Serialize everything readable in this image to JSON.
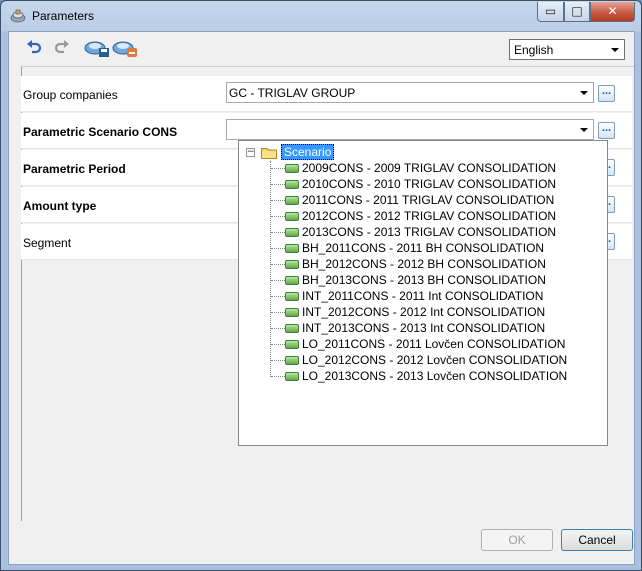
{
  "window": {
    "title": "Parameters"
  },
  "caption_buttons": {
    "minimize": "▭",
    "maximize": "□",
    "close": "✕"
  },
  "toolbar": {
    "icons": [
      "undo-icon",
      "redo-icon",
      "save-settings-icon",
      "delete-settings-icon"
    ],
    "language": "English"
  },
  "params": {
    "rows": [
      {
        "label": "Group companies",
        "value": "GC - TRIGLAV GROUP"
      },
      {
        "label": "Parametric Scenario CONS",
        "value": ""
      },
      {
        "label": "Parametric Period",
        "value": ""
      },
      {
        "label": "Amount type",
        "value": ""
      },
      {
        "label": "Segment",
        "value": ""
      }
    ],
    "ellipsis": "..."
  },
  "tree": {
    "root": "Scenario",
    "expander": "−",
    "items": [
      "2009CONS - 2009 TRIGLAV CONSOLIDATION",
      "2010CONS - 2010 TRIGLAV CONSOLIDATION",
      "2011CONS - 2011 TRIGLAV CONSOLIDATION",
      "2012CONS - 2012 TRIGLAV CONSOLIDATION",
      "2013CONS - 2013 TRIGLAV CONSOLIDATION",
      "BH_2011CONS - 2011 BH CONSOLIDATION",
      "BH_2012CONS - 2012 BH CONSOLIDATION",
      "BH_2013CONS - 2013 BH CONSOLIDATION",
      "INT_2011CONS - 2011 Int CONSOLIDATION",
      "INT_2012CONS - 2012 Int CONSOLIDATION",
      "INT_2013CONS - 2013 Int CONSOLIDATION",
      "LO_2011CONS - 2011 Lovčen CONSOLIDATION",
      "LO_2012CONS - 2012 Lovčen CONSOLIDATION",
      "LO_2013CONS - 2013 Lovčen CONSOLIDATION"
    ]
  },
  "footer": {
    "ok": "OK",
    "cancel": "Cancel"
  }
}
